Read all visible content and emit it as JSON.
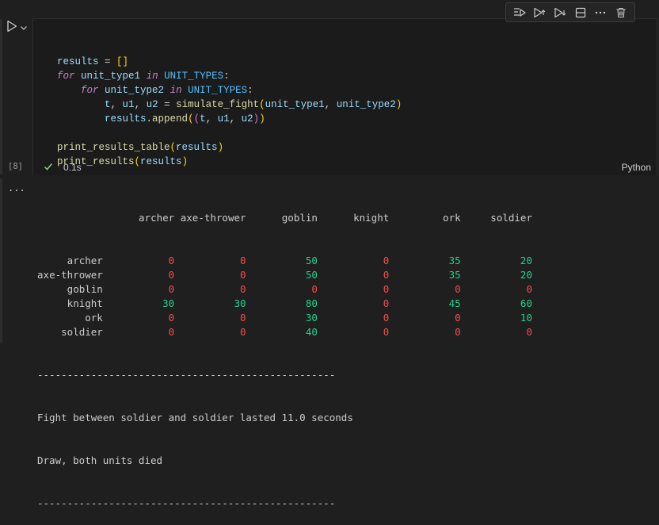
{
  "cell": {
    "execution_count": "[8]",
    "status_time": "0.1s",
    "language": "Python",
    "code_lines": [
      "",
      "results = []",
      "for unit_type1 in UNIT_TYPES:",
      "    for unit_type2 in UNIT_TYPES:",
      "        t, u1, u2 = simulate_fight(unit_type1, unit_type2)",
      "        results.append((t, u1, u2))",
      "",
      "print_results_table(results)",
      "print_results(results)"
    ]
  },
  "toolbar": {
    "icons": [
      "run-by-line-icon",
      "execute-above-icon",
      "execute-below-icon",
      "split-cell-icon",
      "more-icon",
      "delete-icon"
    ]
  },
  "output": {
    "more_label": "...",
    "table": {
      "columns": [
        "archer",
        "axe-thrower",
        "goblin",
        "knight",
        "ork",
        "soldier"
      ],
      "rows": [
        {
          "label": "archer",
          "values": [
            "0",
            "0",
            "50",
            "0",
            "35",
            "20"
          ]
        },
        {
          "label": "axe-thrower",
          "values": [
            "0",
            "0",
            "50",
            "0",
            "35",
            "20"
          ]
        },
        {
          "label": "goblin",
          "values": [
            "0",
            "0",
            "0",
            "0",
            "0",
            "0"
          ]
        },
        {
          "label": "knight",
          "values": [
            "30",
            "30",
            "80",
            "0",
            "45",
            "60"
          ]
        },
        {
          "label": "ork",
          "values": [
            "0",
            "0",
            "30",
            "0",
            "0",
            "10"
          ]
        },
        {
          "label": "soldier",
          "values": [
            "0",
            "0",
            "40",
            "0",
            "0",
            "0"
          ]
        }
      ]
    },
    "separator": "--------------------------------------------------",
    "lines": [
      "Fight between soldier and soldier lasted 11.0 seconds",
      "Draw, both units died"
    ],
    "separator2": "--------------------------------------------------"
  },
  "colors": {
    "zero_value": "#f14c4c",
    "positive_value": "#23d18b",
    "success_check": "#89d185"
  }
}
